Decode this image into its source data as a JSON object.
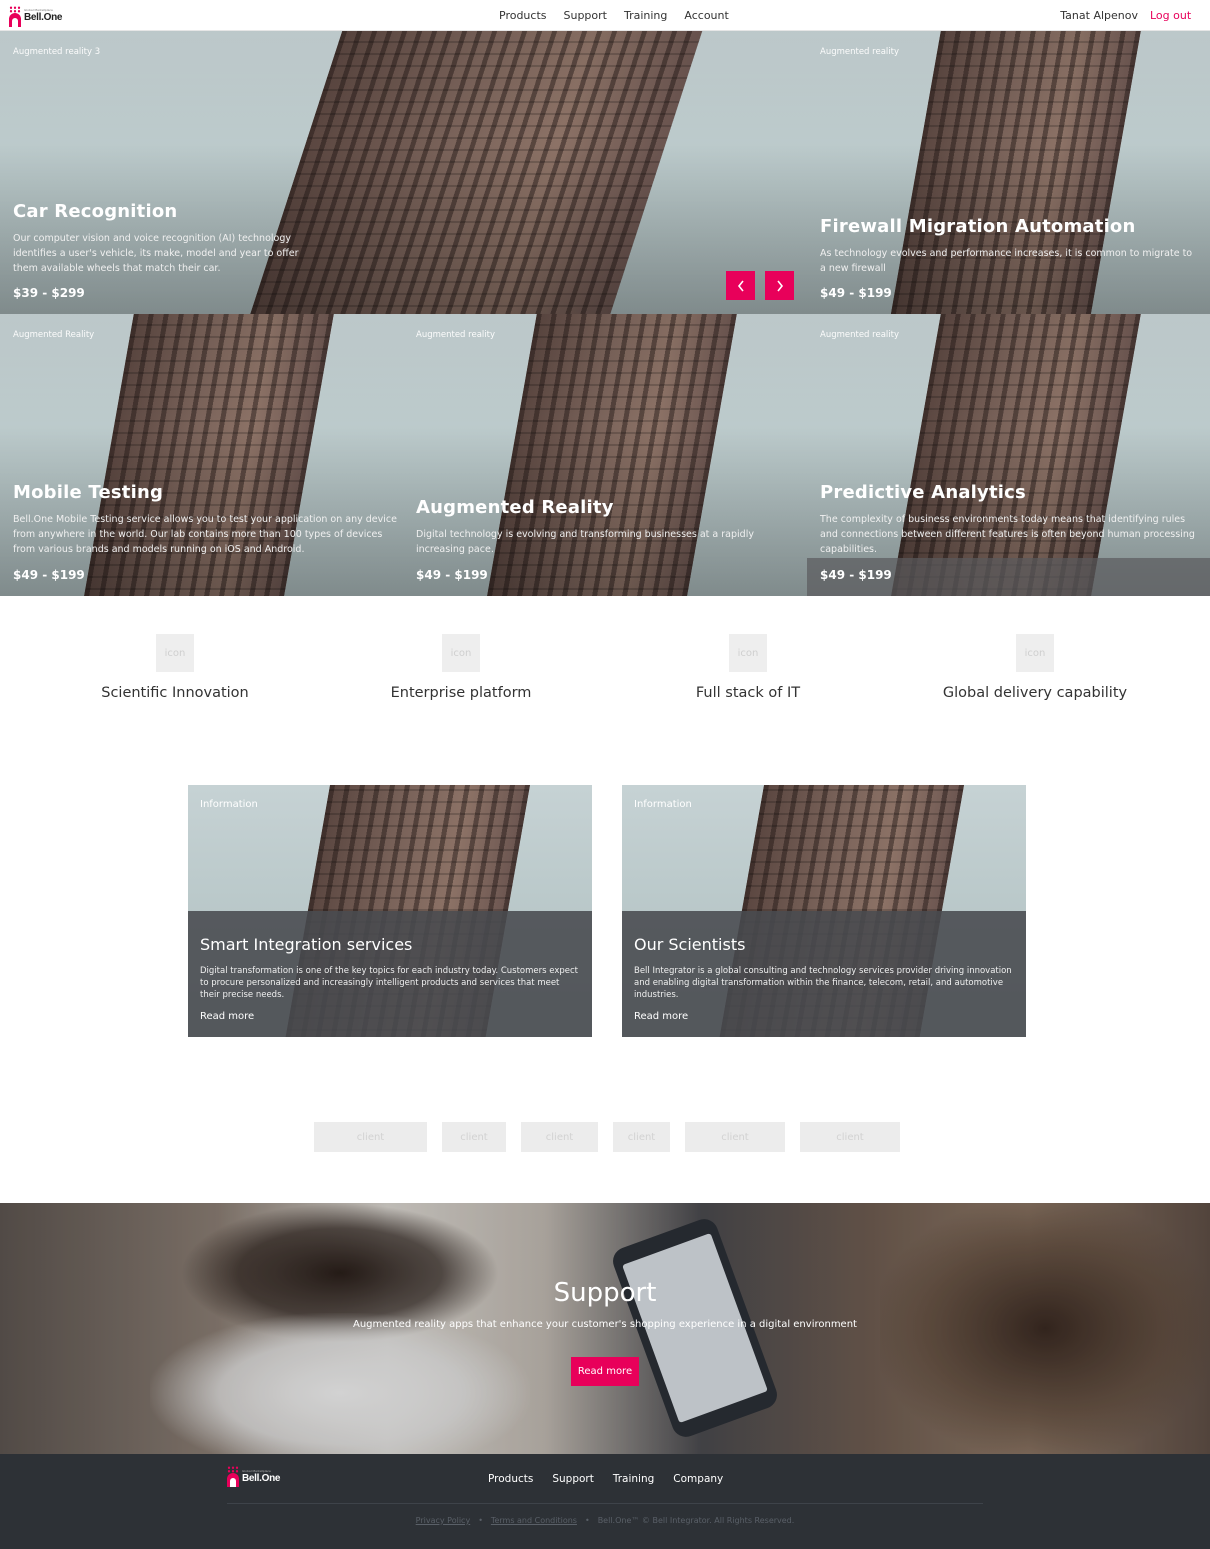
{
  "header": {
    "logo_sub": "Global Marketplace",
    "logo_name": "Bell.One",
    "nav": [
      "Products",
      "Support",
      "Training",
      "Account"
    ],
    "user_name": "Tanat Alpenov",
    "logout": "Log out"
  },
  "hero": {
    "main": {
      "tag": "Augmented reality 3",
      "title": "Car Recognition",
      "desc": "Our computer vision and voice recognition (AI) technology identifies a user's vehicle, its make, model and year to offer them available wheels that match their car.",
      "price": "$39 - $299"
    },
    "side": {
      "tag": "Augmented reality",
      "title": "Firewall Migration Automation",
      "desc": "As technology evolves and performance increases, it is common to migrate to a new firewall",
      "price": "$49 - $199"
    },
    "row": [
      {
        "tag": "Augmented Reality",
        "title": "Mobile Testing",
        "desc": "Bell.One Mobile Testing service allows you to test your application on any device from anywhere in the world. Our lab contains more than 100 types of devices from various brands and models running on iOS and Android.",
        "price": "$49 - $199"
      },
      {
        "tag": "Augmented reality",
        "title": "Augmented Reality",
        "desc": "Digital technology is evolving and transforming businesses at a rapidly increasing pace.",
        "price": "$49 - $199"
      },
      {
        "tag": "Augmented reality",
        "title": "Predictive Analytics",
        "desc": "The complexity of business environments today means that identifying rules and connections between different features is often beyond human processing capabilities.",
        "price": "$49 - $199"
      }
    ]
  },
  "features": [
    {
      "icon": "icon",
      "label": "Scientific Innovation"
    },
    {
      "icon": "icon",
      "label": "Enterprise platform"
    },
    {
      "icon": "icon",
      "label": "Full stack of IT"
    },
    {
      "icon": "icon",
      "label": "Global delivery capability"
    }
  ],
  "info_cards": [
    {
      "tag": "Information",
      "title": "Smart Integration services",
      "desc": "Digital transformation is one of the key topics for each industry today. Customers expect to procure personalized and increasingly intelligent products and services that meet their precise needs.",
      "more": "Read more"
    },
    {
      "tag": "Information",
      "title": "Our Scientists",
      "desc": "Bell Integrator is a global consulting and technology services provider driving innovation and enabling digital transformation within the finance, telecom, retail, and automotive industries.",
      "more": "Read more"
    }
  ],
  "clients": [
    "client",
    "client",
    "client",
    "client",
    "client",
    "client"
  ],
  "support": {
    "title": "Support",
    "subtitle": "Augmented reality apps that enhance your customer's shopping experience in a digital environment",
    "button": "Read more"
  },
  "footer": {
    "logo_sub": "Global Marketplace",
    "logo_name": "Bell.One",
    "nav": [
      "Products",
      "Support",
      "Training",
      "Company"
    ],
    "privacy": "Privacy Policy",
    "terms": "Terms and Conditions",
    "copyright": "Bell.One™ © Bell Integrator. All Rights Reserved."
  },
  "colors": {
    "accent": "#e8005a",
    "footer_bg": "#2d3136",
    "card_panel": "#484a4e"
  }
}
